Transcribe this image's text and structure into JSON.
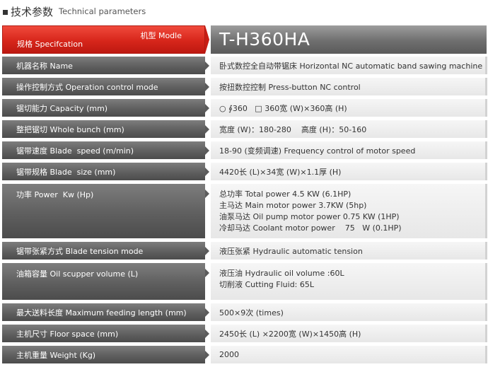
{
  "title": {
    "cn": "技术参数",
    "en": "Technical parameters"
  },
  "header": {
    "model_label": "机型 Modle",
    "spec_label": "规格 Specifcation",
    "model_value": "T-H360HA"
  },
  "rows": [
    {
      "label": "机器名称 Name",
      "values": [
        "卧式数控全自动带锯床 Horizontal NC automatic band sawing machine"
      ]
    },
    {
      "label": "操作控制方式 Operation control mode",
      "values": [
        "按扭数控控制 Press-button NC control"
      ]
    },
    {
      "label": "锯切能力 Capacity (mm)",
      "values": [
        "○ ∮360   □ 360宽 (W)×360高 (H)"
      ]
    },
    {
      "label": "整把锯切 Whole bunch (mm)",
      "values": [
        "宽度 (W)：180-280    高度 (H)：50-160"
      ]
    },
    {
      "label": "锯带速度 Blade  speed (m/min)",
      "values": [
        "18-90 (变频调速) Frequency control of motor speed"
      ]
    },
    {
      "label": "锯带规格 Blade  size (mm)",
      "values": [
        "4420长 (L)×34宽 (W)×1.1厚 (H)"
      ]
    },
    {
      "label": "功率 Power  Kw (Hp)",
      "values": [
        "总功率 Total power 4.5 KW (6.1HP)",
        "主马达 Main motor power 3.7KW (5hp)",
        "油泵马达 Oil pump motor power 0.75 KW (1HP)",
        "冷却马达 Coolant motor power    75   W (0.1HP)"
      ]
    },
    {
      "label": "锯带张紧方式 Blade tension mode",
      "values": [
        "液压张紧 Hydraulic automatic tension"
      ]
    },
    {
      "label": "油箱容量 Oil scupper volume (L)",
      "values": [
        "液压油 Hydraulic oil volume :60L",
        "切削液 Cutting Fluid: 65L"
      ]
    },
    {
      "label": "最大送料长度 Maximum feeding length (mm)",
      "values": [
        "500×9次 (times)"
      ]
    },
    {
      "label": "主机尺寸 Floor space (mm)",
      "values": [
        "2450长 (L) ×2200宽 (W)×1450高 (H)"
      ]
    },
    {
      "label": "主机重量 Weight (Kg)",
      "values": [
        "2000"
      ]
    }
  ]
}
